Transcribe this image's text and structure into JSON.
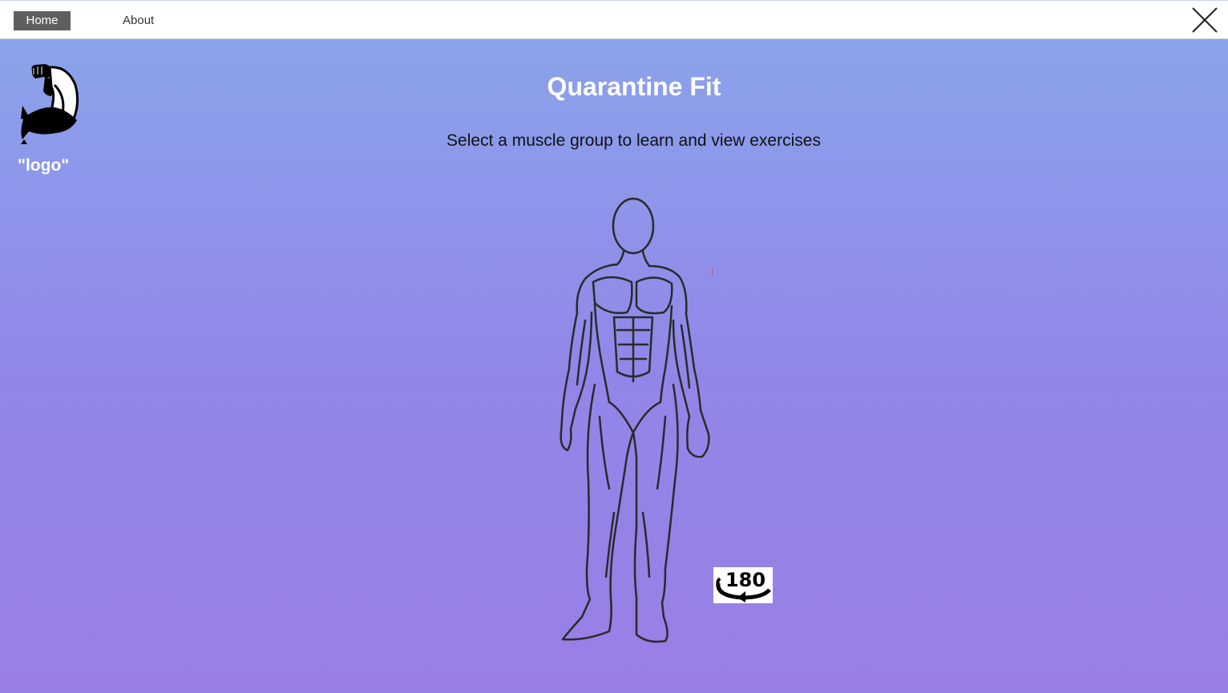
{
  "nav": {
    "home_label": "Home",
    "about_label": "About"
  },
  "logo": {
    "text": "\"logo\"",
    "icon": "flexed-bicep-icon"
  },
  "main": {
    "title": "Quarantine Fit",
    "subtitle": "Select a muscle group to learn and view exercises"
  },
  "rotate_button": {
    "label": "180",
    "icon": "rotate-180-icon"
  },
  "colors": {
    "gradient_top": "#8aa6eb",
    "gradient_bottom": "#9a7ee6",
    "nav_active_bg": "#5f5f5f"
  }
}
